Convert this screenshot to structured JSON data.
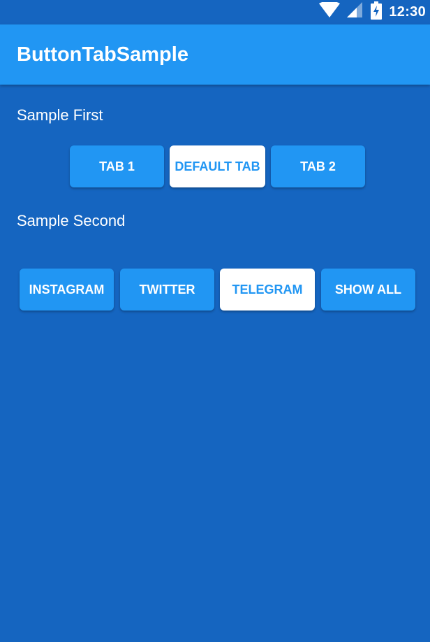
{
  "status_bar": {
    "time": "12:30",
    "icons": [
      "wifi-icon",
      "signal-icon",
      "battery-charging-icon"
    ]
  },
  "app_bar": {
    "title": "ButtonTabSample"
  },
  "sections": [
    {
      "label": "Sample First",
      "tabs": [
        {
          "label": "TAB 1",
          "selected": false
        },
        {
          "label": "DEFAULT TAB",
          "selected": true
        },
        {
          "label": "TAB 2",
          "selected": false
        }
      ]
    },
    {
      "label": "Sample Second",
      "tabs": [
        {
          "label": "INSTAGRAM",
          "selected": false
        },
        {
          "label": "TWITTER",
          "selected": false
        },
        {
          "label": "TELEGRAM",
          "selected": true
        },
        {
          "label": "SHOW ALL",
          "selected": false
        }
      ]
    }
  ],
  "colors": {
    "background": "#1565C0",
    "app_bar": "#2196F3",
    "tab": "#2196F3",
    "tab_selected_bg": "#FFFFFF",
    "tab_selected_text": "#2196F3",
    "text": "#FFFFFF"
  }
}
